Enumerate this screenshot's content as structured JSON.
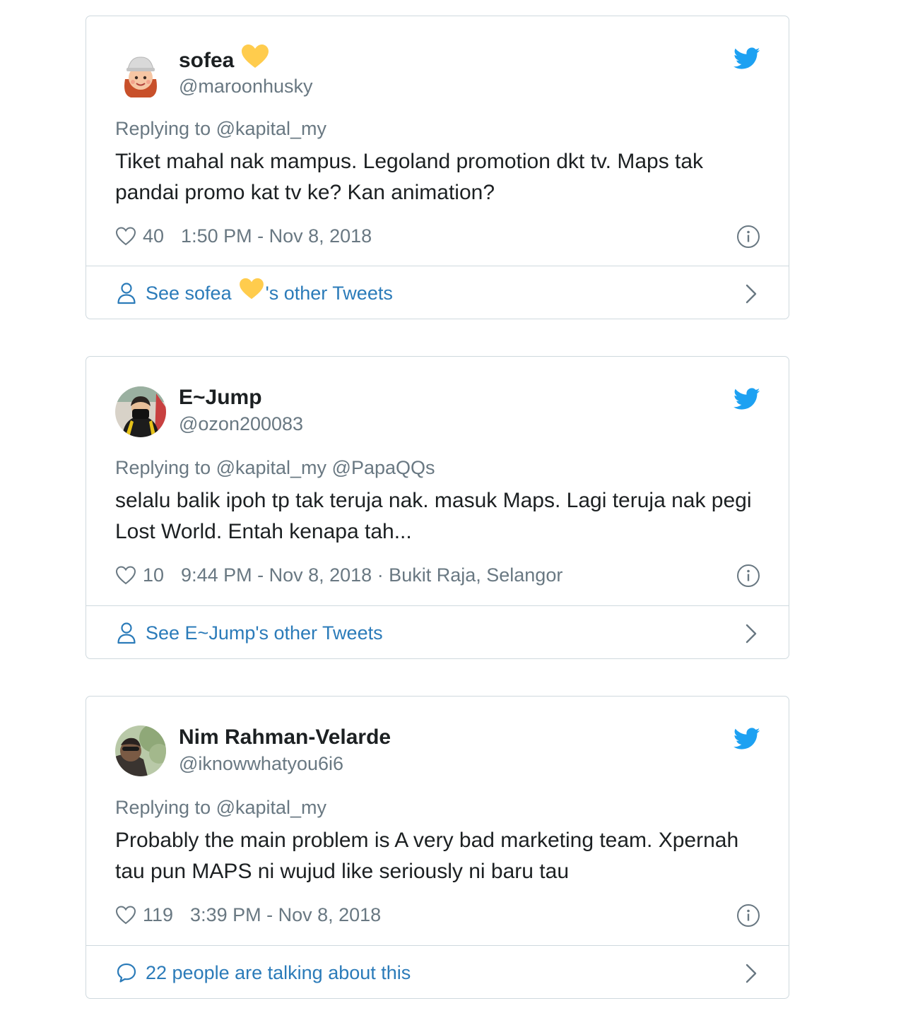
{
  "tweets": [
    {
      "name": "sofea",
      "name_emoji": "yellow-heart",
      "handle": "@maroonhusky",
      "replying": "Replying to @kapital_my",
      "text": "Tiket mahal nak mampus. Legoland promotion dkt tv. Maps tak pandai promo kat tv ke? Kan animation?",
      "likes": "40",
      "timestamp": "1:50 PM - Nov 8, 2018",
      "footer_prefix": "See sofea",
      "footer_suffix": "'s other Tweets"
    },
    {
      "name": "E~Jump",
      "handle": "@ozon200083",
      "replying": "Replying to @kapital_my @PapaQQs",
      "text": "selalu balik ipoh tp tak teruja nak. masuk Maps. Lagi teruja nak pegi Lost World. Entah kenapa tah...",
      "likes": "10",
      "timestamp": "9:44 PM - Nov 8, 2018 · Bukit Raja, Selangor",
      "footer": "See E~Jump's other Tweets"
    },
    {
      "name": "Nim Rahman-Velarde",
      "handle": "@iknowwhatyou6i6",
      "replying": "Replying to @kapital_my",
      "text": "Probably the main problem is A very bad marketing team. Xpernah tau pun MAPS ni wujud like seriously ni baru tau",
      "likes": "119",
      "timestamp": "3:39 PM - Nov 8, 2018",
      "footer": "22 people are talking about this"
    }
  ],
  "colors": {
    "twitter_blue": "#1da1f2",
    "link_blue": "#2b7bb9",
    "muted_text": "#697882",
    "border": "#cfd9de",
    "heart_emoji": "#ffcc4d"
  }
}
